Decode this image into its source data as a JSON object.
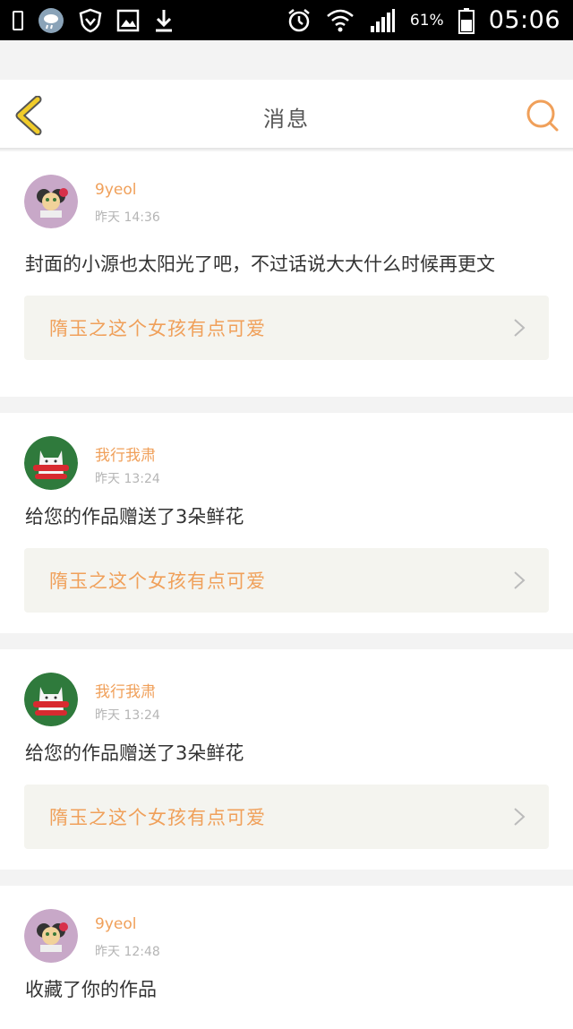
{
  "status_bar": {
    "battery_percent": "61%",
    "clock": "05:06"
  },
  "nav": {
    "title": "消息"
  },
  "colors": {
    "accent": "#f0a05a",
    "back_icon": "#f1cc2a",
    "ref_bg": "#f4f4ef"
  },
  "messages": [
    {
      "user": "9yeol",
      "time": "昨天 14:36",
      "text": "封面的小源也太阳光了吧，不过话说大大什么时候再更文",
      "ref_title": "隋玉之这个女孩有点可爱",
      "avatar": "powerpuff-avatar"
    },
    {
      "user": "我行我肃",
      "time": "昨天 13:24",
      "text": "给您的作品赠送了3朵鲜花",
      "ref_title": "隋玉之这个女孩有点可爱",
      "avatar": "cat-avatar"
    },
    {
      "user": "我行我肃",
      "time": "昨天 13:24",
      "text": "给您的作品赠送了3朵鲜花",
      "ref_title": "隋玉之这个女孩有点可爱",
      "avatar": "cat-avatar"
    },
    {
      "user": "9yeol",
      "time": "昨天 12:48",
      "text": "收藏了你的作品",
      "avatar": "powerpuff-avatar"
    }
  ]
}
